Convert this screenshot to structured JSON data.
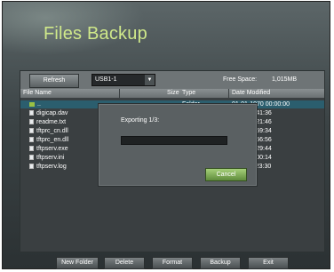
{
  "window": {
    "title": "Files Backup"
  },
  "toolbar": {
    "refresh_label": "Refresh",
    "device_selected": "USB1-1",
    "free_space_label": "Free Space:",
    "free_space_value": "1,015MB"
  },
  "list": {
    "columns": {
      "name": "File Name",
      "size": "Size",
      "type": "Type",
      "date": "Date Modified"
    },
    "rows": [
      {
        "name": "..",
        "size": "",
        "type": "Folder",
        "date": "01-01-1970 00:00:00",
        "icon": "folder-up-icon"
      },
      {
        "name": "digicap.dav",
        "size": "",
        "type": "",
        "date": "2009 19:41:36",
        "icon": "file-icon"
      },
      {
        "name": "readme.txt",
        "size": "",
        "type": "",
        "date": "2008 15:21:46",
        "icon": "file-icon"
      },
      {
        "name": "tftprc_cn.dll",
        "size": "",
        "type": "",
        "date": "2007 13:59:34",
        "icon": "file-icon"
      },
      {
        "name": "tftprc_en.dll",
        "size": "",
        "type": "",
        "date": "2007 13:56:56",
        "icon": "file-icon"
      },
      {
        "name": "tftpserv.exe",
        "size": "",
        "type": "",
        "date": "2008 15:29:44",
        "icon": "file-icon"
      },
      {
        "name": "tftpserv.ini",
        "size": "",
        "type": "",
        "date": "2009 14:00:14",
        "icon": "file-icon"
      },
      {
        "name": "tftpserv.log",
        "size": "",
        "type": "",
        "date": "2009 11:23:30",
        "icon": "file-icon"
      }
    ]
  },
  "dialog": {
    "message": "Exporting 1/3:",
    "progress": 0,
    "cancel_label": "Cancel"
  },
  "bottom": {
    "new_folder": "New Folder",
    "delete": "Delete",
    "format": "Format",
    "backup": "Backup",
    "exit": "Exit"
  },
  "colors": {
    "title": "#cfe88a",
    "selected_row": "#2b5e6e",
    "cancel_button": "#7fb050"
  }
}
